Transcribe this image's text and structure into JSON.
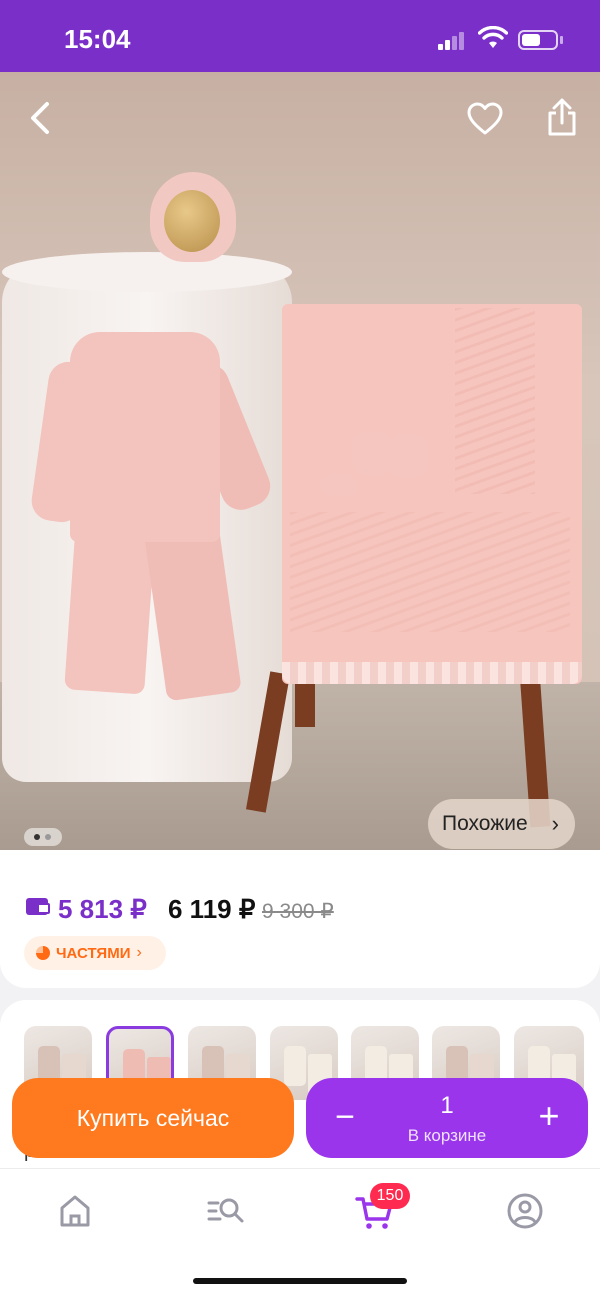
{
  "status_bar": {
    "time": "15:04"
  },
  "gallery": {
    "similar_label": "Похожие",
    "chevron_icon": "chevron-right-icon",
    "icons": [
      "back-icon",
      "heart-icon",
      "share-icon"
    ],
    "page_count": 2,
    "current_page": 1
  },
  "price": {
    "wallet_price": "5 813 ₽",
    "price": "6 119 ₽",
    "old_price": "9 300 ₽",
    "installments_label": "ЧАСТЯМИ"
  },
  "variants": {
    "thumbnail_count": 8,
    "selected_index": 1,
    "text": "розовый"
  },
  "actions": {
    "buy_now_label": "Купить сейчас",
    "quantity": "1",
    "in_cart_label": "В корзине"
  },
  "nav": {
    "items": [
      "home-icon",
      "catalog-search-icon",
      "cart-icon",
      "profile-icon"
    ],
    "cart_badge": "150"
  },
  "colors": {
    "brand_purple": "#7b2fc9",
    "cart_button": "#9a35ec",
    "buy_button": "#ff7a1f",
    "badge_red": "#ff2a4f"
  }
}
